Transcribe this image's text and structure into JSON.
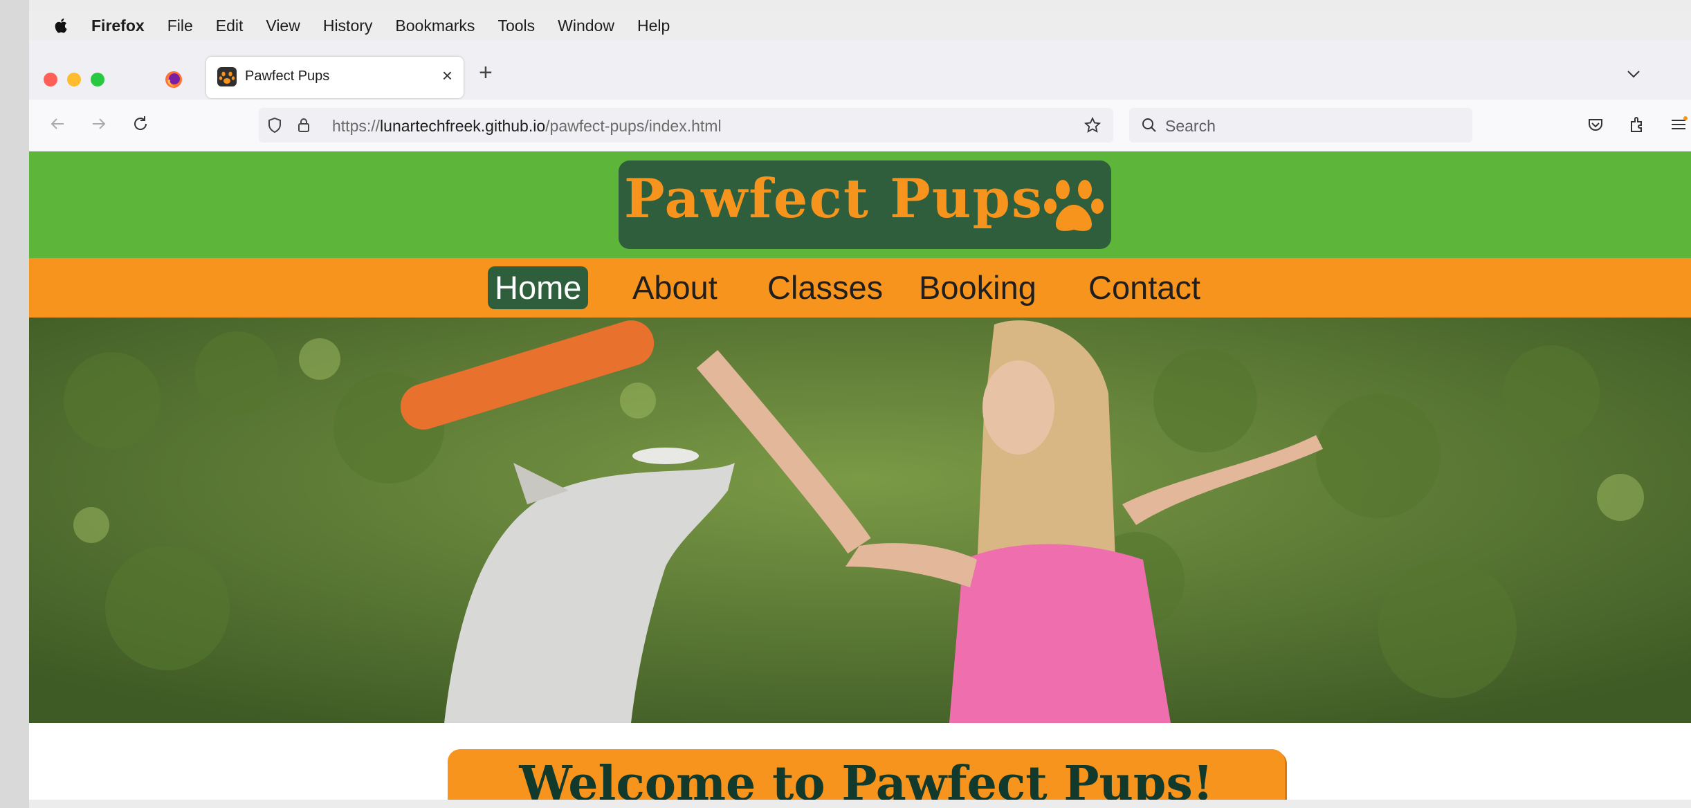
{
  "menubar": {
    "app_name": "Firefox",
    "items": [
      "File",
      "Edit",
      "View",
      "History",
      "Bookmarks",
      "Tools",
      "Window",
      "Help"
    ]
  },
  "tabs": [
    {
      "title": "Pawfect Pups",
      "active": true
    }
  ],
  "toolbar": {
    "url_scheme": "https://",
    "url_host": "lunartechfreek.github.io",
    "url_path": "/pawfect-pups/index.html",
    "search_placeholder": "Search"
  },
  "site": {
    "logo_text": "Pawfect Pups",
    "nav": [
      "Home",
      "About",
      "Classes",
      "Booking",
      "Contact"
    ],
    "active_nav": "Home",
    "welcome_heading": "Welcome to Pawfect Pups!"
  },
  "colors": {
    "header_green": "#5db63a",
    "logo_dark_green": "#2f5e3c",
    "accent_orange": "#f7941d",
    "welcome_text": "#123a2c"
  },
  "icons": [
    "apple-icon",
    "firefox-icon",
    "paw-icon",
    "close-icon",
    "plus-icon",
    "chevron-down-icon",
    "back-arrow-icon",
    "forward-arrow-icon",
    "reload-icon",
    "shield-icon",
    "lock-icon",
    "star-icon",
    "search-icon",
    "pocket-icon",
    "extensions-icon",
    "menu-icon"
  ]
}
